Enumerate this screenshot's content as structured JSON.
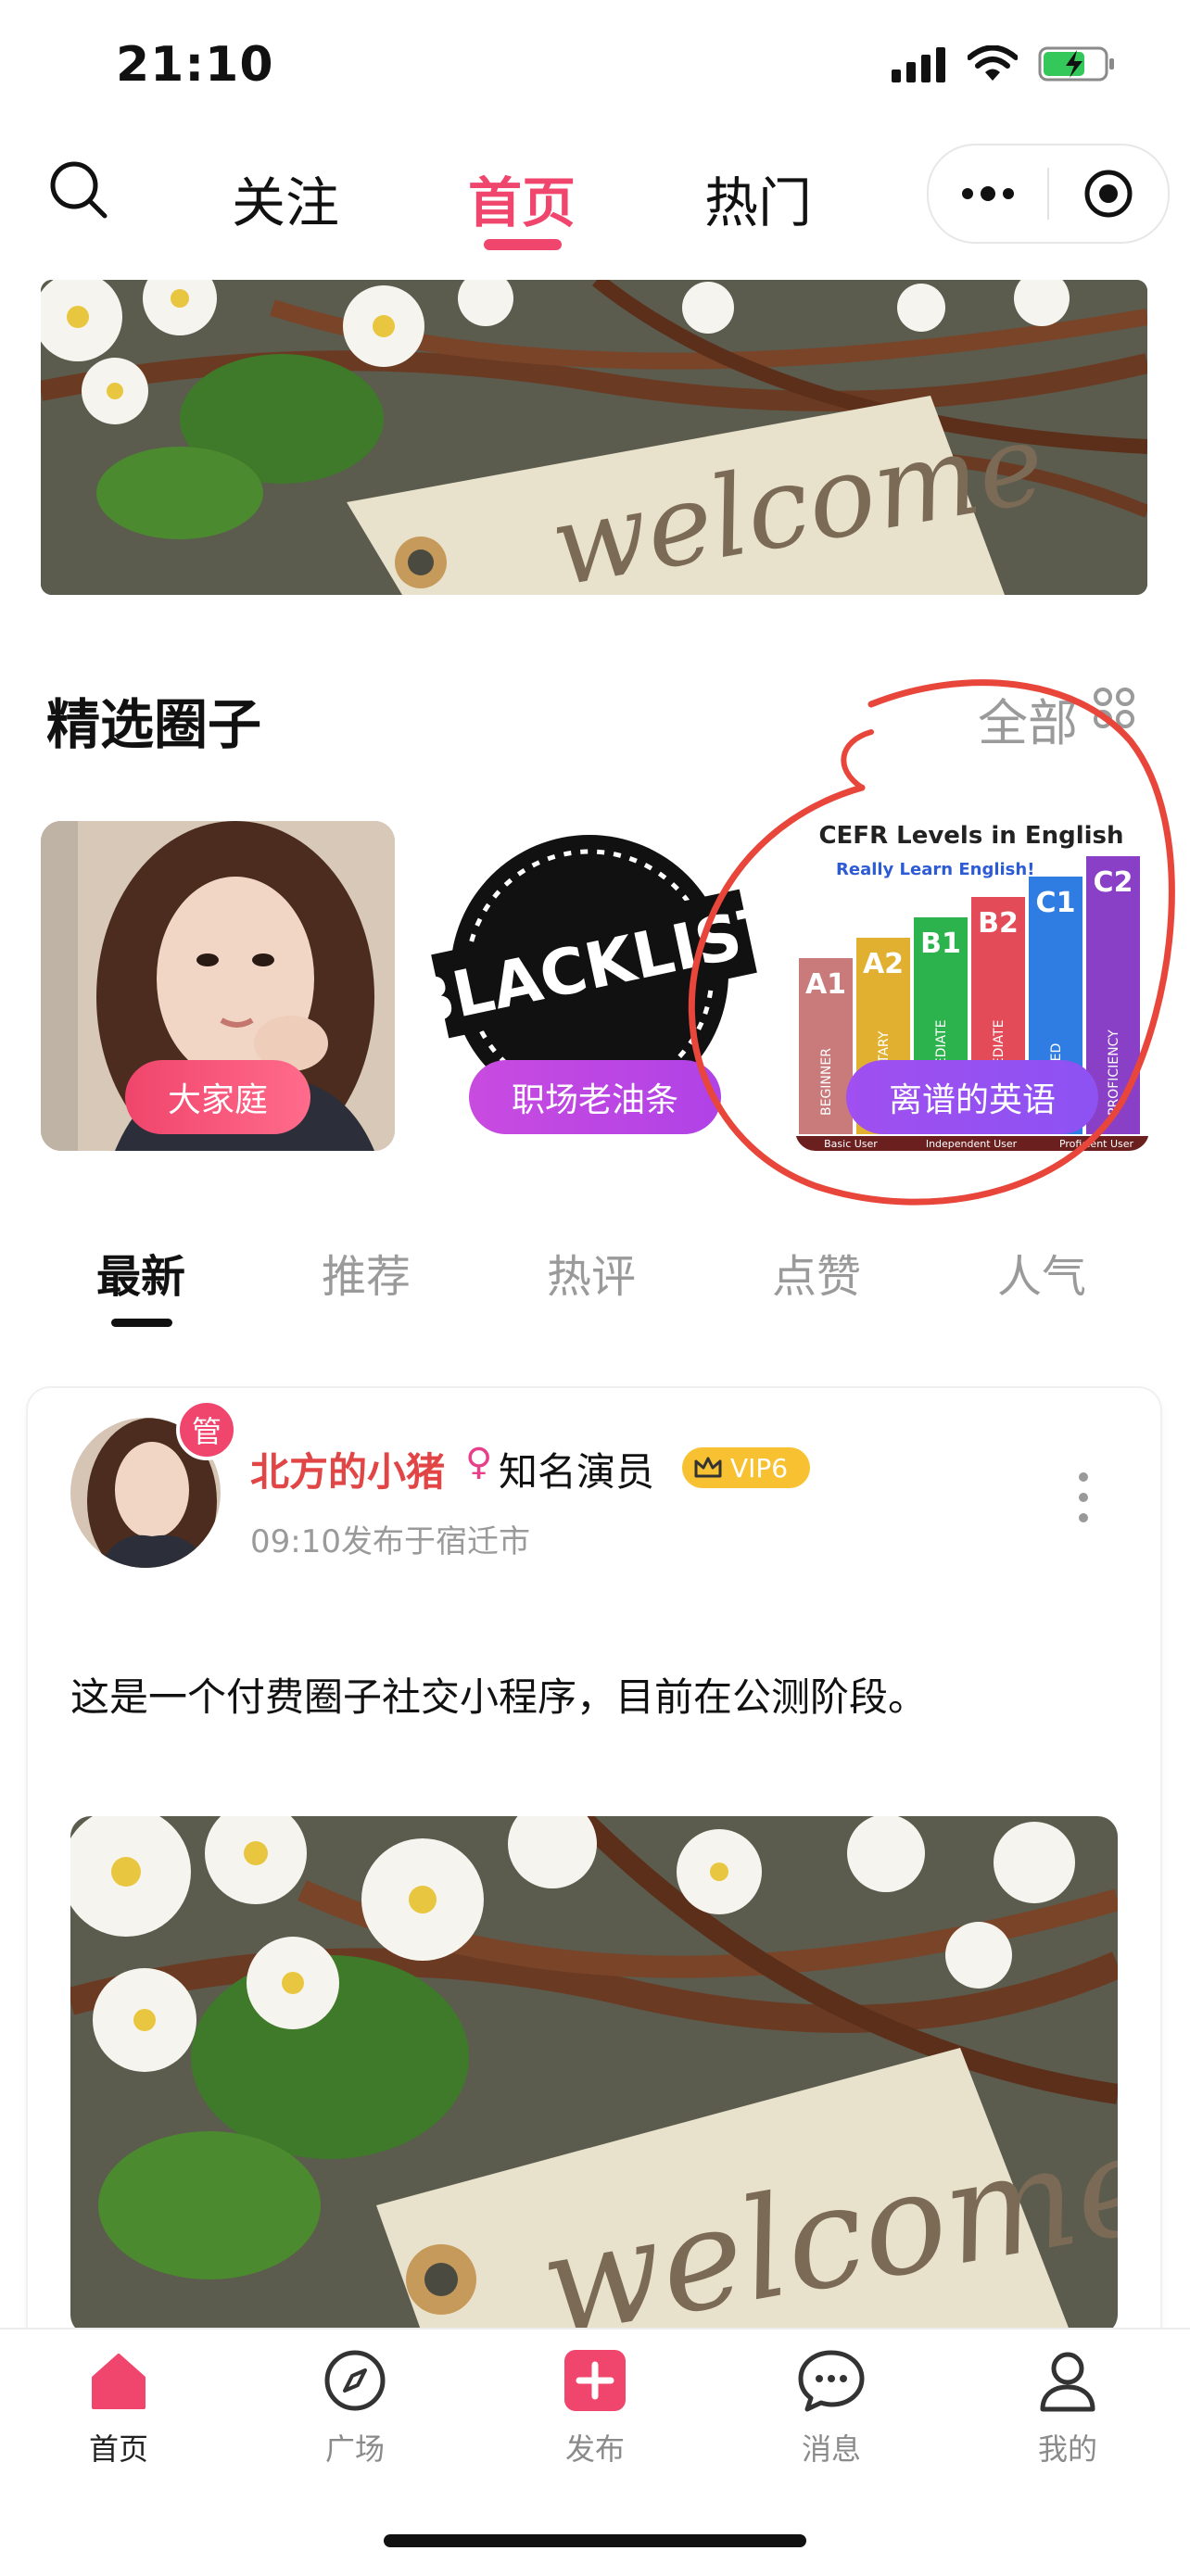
{
  "status_bar": {
    "time": "21:10",
    "icons": [
      "signal-icon",
      "wifi-icon",
      "battery-charging-icon"
    ]
  },
  "top_nav": {
    "tabs": [
      {
        "label": "关注",
        "active": false
      },
      {
        "label": "首页",
        "active": true
      },
      {
        "label": "热门",
        "active": false
      }
    ],
    "accent_color": "#f0456c"
  },
  "banner": {
    "text": "welcome"
  },
  "featured_circles": {
    "title": "精选圈子",
    "all_label": "全部",
    "items": [
      {
        "label": "大家庭"
      },
      {
        "label": "职场老油条",
        "image_text": "BLACKLIST"
      },
      {
        "label": "离谱的英语"
      }
    ],
    "cefr_chart": {
      "title": "CEFR Levels in English",
      "subtitle": "Really Learn English!",
      "levels": [
        {
          "code": "A1",
          "desc": "BEGINNER"
        },
        {
          "code": "A2",
          "desc": "ELEMENTARY"
        },
        {
          "code": "B1",
          "desc": "INTERMEDIATE"
        },
        {
          "code": "B2",
          "desc": "INTERMEDIATE"
        },
        {
          "code": "C1",
          "desc": "ADVANCED"
        },
        {
          "code": "C2",
          "desc": "PROFICIENCY"
        }
      ],
      "groups": [
        "Basic User",
        "Independent User",
        "Proficient User"
      ]
    }
  },
  "sort_tabs": [
    {
      "label": "最新",
      "active": true
    },
    {
      "label": "推荐",
      "active": false
    },
    {
      "label": "热评",
      "active": false
    },
    {
      "label": "点赞",
      "active": false
    },
    {
      "label": "人气",
      "active": false
    }
  ],
  "post": {
    "admin_badge": "管",
    "author": "北方的小猪",
    "gender_symbol": "♀",
    "author_title": "知名演员",
    "vip": "VIP6",
    "meta": "09:10发布于宿迁市",
    "content": "这是一个付费圈子社交小程序，目前在公测阶段。",
    "image_text": "welcome"
  },
  "tab_bar": [
    {
      "label": "首页",
      "icon": "home-icon",
      "active": true
    },
    {
      "label": "广场",
      "icon": "compass-icon",
      "active": false
    },
    {
      "label": "发布",
      "icon": "plus-icon",
      "active": false
    },
    {
      "label": "消息",
      "icon": "message-icon",
      "active": false
    },
    {
      "label": "我的",
      "icon": "user-icon",
      "active": false
    }
  ]
}
